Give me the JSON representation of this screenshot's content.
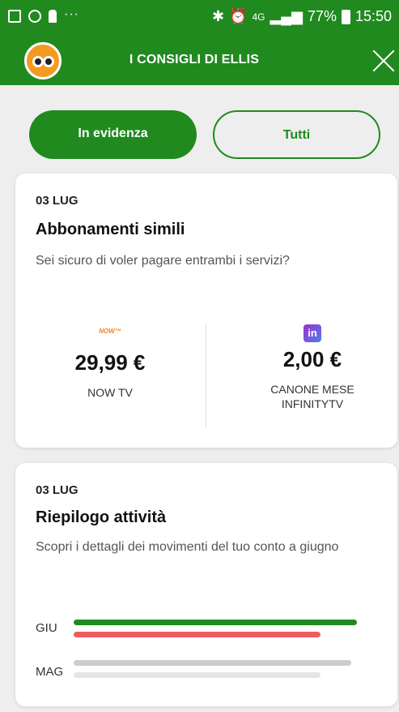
{
  "status_bar": {
    "network": "4G",
    "battery": "77%",
    "time": "15:50",
    "more": "···",
    "icons": [
      "gallery-icon",
      "sync-icon",
      "figure-icon",
      "bluetooth-icon",
      "alarm-icon",
      "signal-icon",
      "battery-icon"
    ]
  },
  "header": {
    "title": "I CONSIGLI DI ELLIS",
    "logo": "ellis-logo",
    "close_icon": "close-icon"
  },
  "tabs": {
    "active": "In evidenza",
    "inactive": "Tutti"
  },
  "colors": {
    "primary": "#208a1f",
    "accent_red": "#ee5c5c",
    "bar_grey": "#cccccc",
    "bar_grey_light": "#e5e5e5"
  },
  "cards": [
    {
      "date": "03 LUG",
      "title": "Abbonamenti simili",
      "description": "Sei sicuro di voler pagare entrambi i servizi?",
      "services": [
        {
          "logo_text": "NOW™",
          "amount": "29,99 €",
          "name": "NOW TV"
        },
        {
          "logo_text": "in",
          "amount": "2,00 €",
          "name": "CANONE MESE INFINITYTV"
        }
      ]
    },
    {
      "date": "03 LUG",
      "title": "Riepilogo attività",
      "description": "Scopri i dettagli dei movimenti del tuo conto a giugno",
      "bars": [
        {
          "label": "GIU",
          "income_fraction": 1.0,
          "expense_fraction": 0.87
        },
        {
          "label": "MAG",
          "income_fraction": 0.98,
          "expense_fraction": 0.87
        }
      ]
    }
  ]
}
